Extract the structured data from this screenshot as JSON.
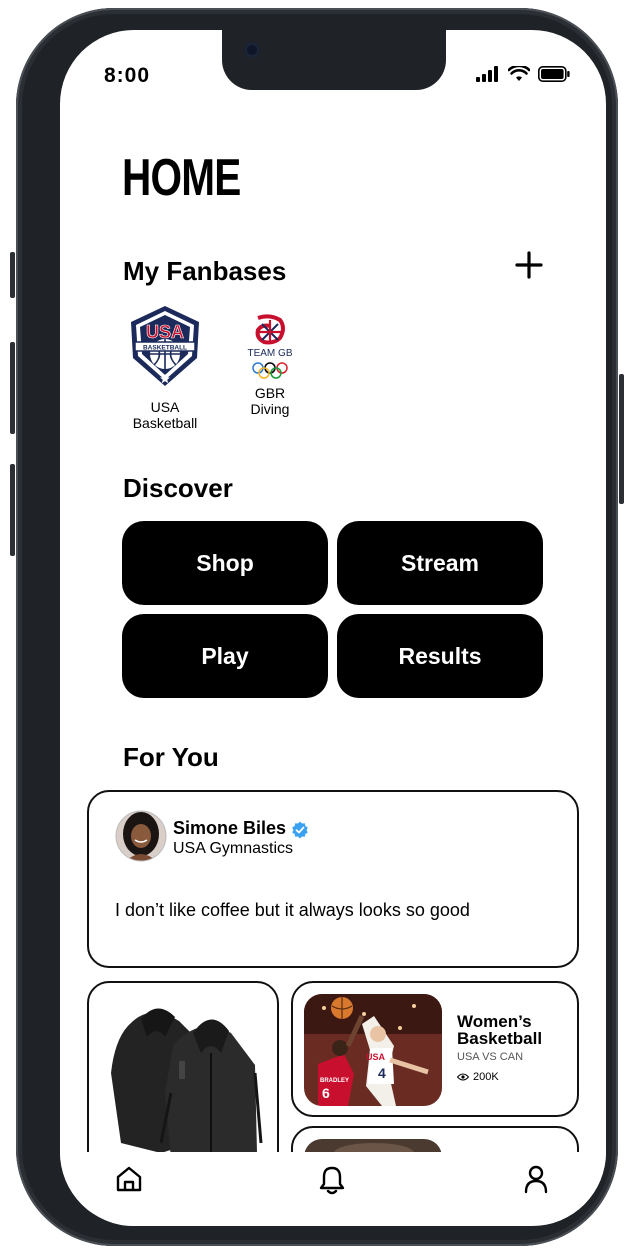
{
  "status_bar": {
    "time": "8:00"
  },
  "page": {
    "title": "HOME"
  },
  "fanbases": {
    "title": "My Fanbases",
    "add_label": "+",
    "items": [
      {
        "line1": "USA",
        "line2": "Basketball",
        "logo_text": "USA",
        "logo_sub": "BASKETBALL"
      },
      {
        "line1": "GBR",
        "line2": "Diving",
        "logo_text": "TEAM GB"
      }
    ]
  },
  "discover": {
    "title": "Discover",
    "buttons": [
      "Shop",
      "Stream",
      "Play",
      "Results"
    ]
  },
  "for_you": {
    "title": "For You",
    "post": {
      "author": "Simone Biles",
      "org": "USA Gymnastics",
      "text": "I don’t like coffee but it always looks so good"
    },
    "stream_card": {
      "title_line1": "Women’s",
      "title_line2": "Basketball",
      "subtitle": "USA VS CAN",
      "views": "200K",
      "jersey_a": "6",
      "jersey_b": "4",
      "jersey_a_name": "BRADLEY",
      "jersey_b_text": "USA"
    }
  },
  "colors": {
    "accent": "#000000",
    "verified": "#3aa0f0",
    "usa_navy": "#1b2a5a",
    "usa_red": "#c8102e"
  },
  "icons": [
    "home-icon",
    "bell-icon",
    "profile-icon",
    "plus-icon",
    "verified-icon",
    "eye-icon"
  ]
}
